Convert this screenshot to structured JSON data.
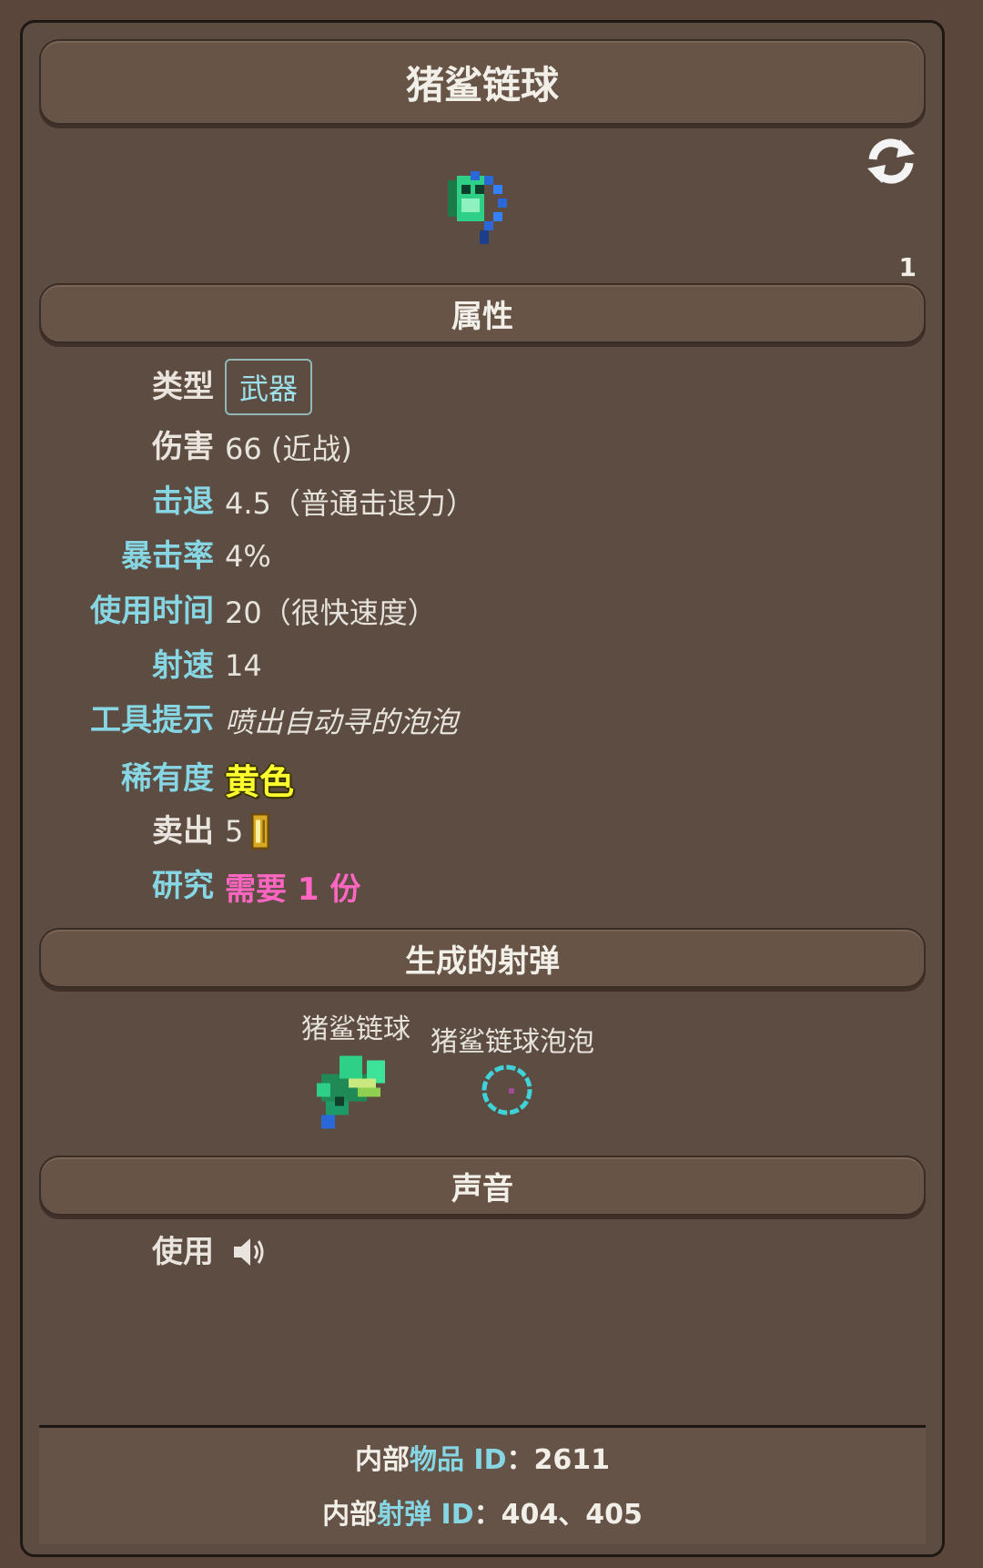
{
  "title": "猪鲨链球",
  "sections": {
    "attributes": "属性",
    "projectiles": "生成的射弹",
    "sounds": "声音"
  },
  "side_mark": "1",
  "stats": {
    "type_label": "类型",
    "type_value": "武器",
    "damage_label": "伤害",
    "damage_value": "66 (近战)",
    "knockback_label": "击退",
    "knockback_value": "4.5（普通击退力）",
    "crit_label": "暴击率",
    "crit_value": "4%",
    "usetime_label": "使用时间",
    "usetime_value": "20（很快速度）",
    "velocity_label": "射速",
    "velocity_value": "14",
    "tooltip_label": "工具提示",
    "tooltip_value": "喷出自动寻的泡泡",
    "rarity_label": "稀有度",
    "rarity_value": "黄色",
    "sell_label": "卖出",
    "sell_value": "5",
    "research_label": "研究",
    "research_value": "需要 1 份"
  },
  "projectiles": [
    {
      "name": "猪鲨链球",
      "icon": "flail-head-icon"
    },
    {
      "name": "猪鲨链球泡泡",
      "icon": "bubble-icon"
    }
  ],
  "sound": {
    "label": "使用",
    "icon": "speaker-icon"
  },
  "footer": {
    "item_prefix": "内部",
    "item_key": "物品 ID",
    "item_value": "：2611",
    "proj_prefix": "内部",
    "proj_key": "射弹 ID",
    "proj_value": "：404、405"
  },
  "colors": {
    "background": "#5b463c",
    "panel": "#5c4c41",
    "header": "#675447",
    "cyan_label": "#86d6e4",
    "rarity_yellow": "#ffff2e",
    "research_pink": "#ff66c2"
  }
}
